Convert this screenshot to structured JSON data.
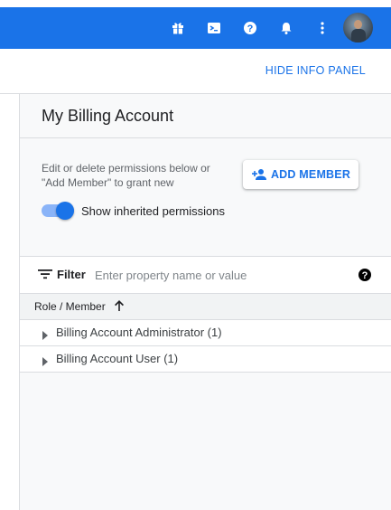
{
  "topbar": {
    "color": "#1a73e8",
    "icons": [
      "gift-icon",
      "cloud-shell-icon",
      "help-icon",
      "notifications-icon",
      "more-vert-icon"
    ],
    "avatar": "user-avatar"
  },
  "subheader": {
    "hide_info_panel": "HIDE INFO PANEL"
  },
  "panel": {
    "title": "My Billing Account",
    "description": "Edit or delete permissions below or \"Add Member\" to grant new",
    "add_member_label": "ADD MEMBER",
    "toggle_label": "Show inherited permissions",
    "toggle_on": true
  },
  "filter": {
    "label": "Filter",
    "placeholder": "Enter property name or value"
  },
  "table": {
    "column_header": "Role / Member",
    "sort": "ascending",
    "rows": [
      {
        "label": "Billing Account Administrator (1)"
      },
      {
        "label": "Billing Account User (1)"
      }
    ]
  }
}
